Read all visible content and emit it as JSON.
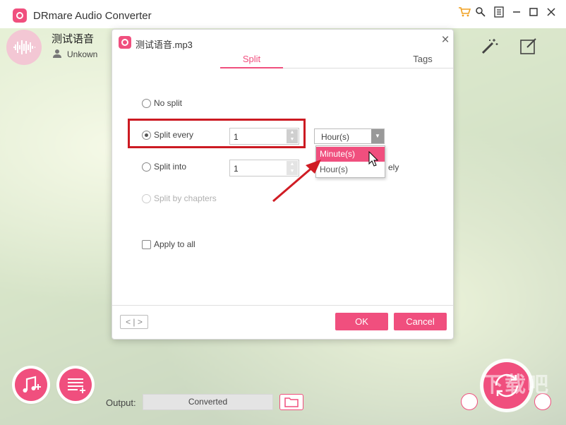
{
  "app": {
    "title": "DRmare Audio Converter",
    "accent": "#f04f7e"
  },
  "window_controls": [
    "cart-icon",
    "key-icon",
    "menu-icon",
    "minimize-icon",
    "maximize-icon",
    "close-icon"
  ],
  "file": {
    "name": "测试语音",
    "artist": "Unkown"
  },
  "dialog": {
    "title": "测试语音.mp3",
    "tabs": [
      {
        "label": "Split",
        "active": true
      },
      {
        "label": "Tags",
        "active": false
      }
    ],
    "options": {
      "no_split": "No split",
      "split_every": "Split every",
      "split_every_value": "1",
      "split_into": "Split into",
      "split_into_value": "1",
      "split_into_suffix": "ely",
      "split_by_chapters": "Split by chapters",
      "apply_to_all": "Apply to all"
    },
    "selected_option": "split_every",
    "unit_select": {
      "value": "Hour(s)",
      "options": [
        "Minute(s)",
        "Hour(s)"
      ],
      "highlighted": "Minute(s)"
    },
    "pager": "< | >",
    "ok_label": "OK",
    "cancel_label": "Cancel"
  },
  "bottom": {
    "output_label": "Output:",
    "output_value": "Converted"
  },
  "watermark": "下载吧"
}
